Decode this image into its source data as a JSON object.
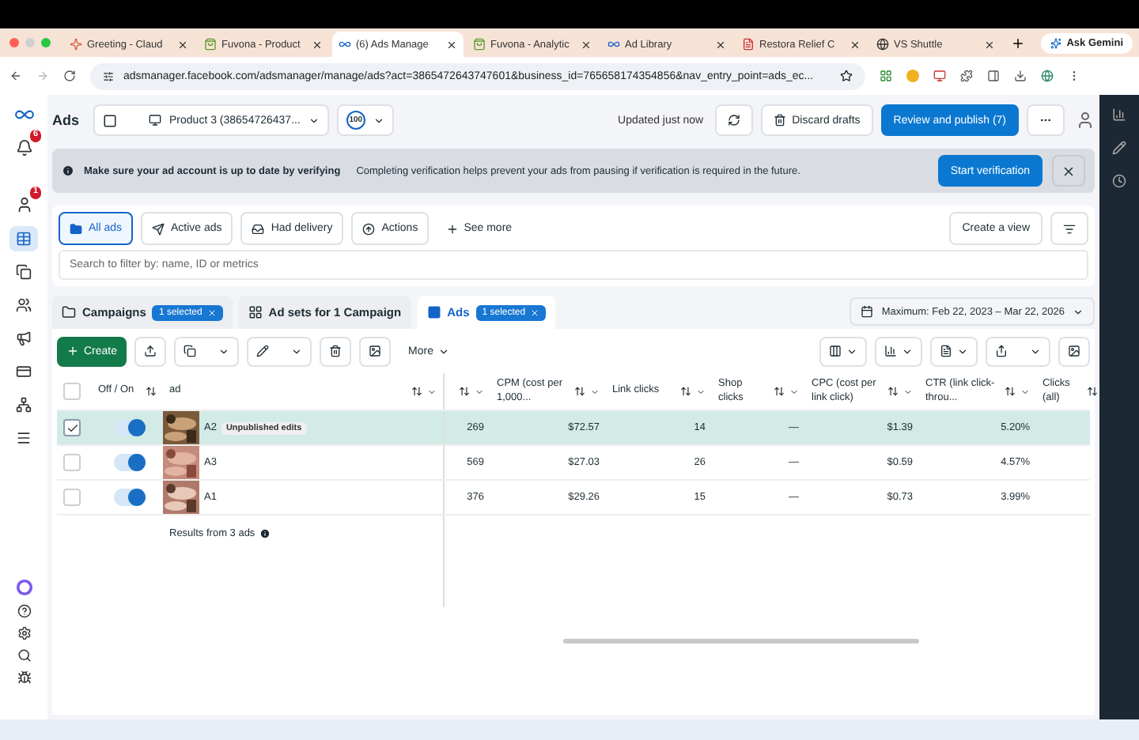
{
  "browser_tabs": [
    {
      "title": "Greeting - Claud",
      "kind": "spark",
      "selected": false
    },
    {
      "title": "Fuvona - Product",
      "kind": "bag",
      "selected": false
    },
    {
      "title": "(6) Ads Manage",
      "kind": "meta",
      "selected": true
    },
    {
      "title": "Fuvona - Analytic",
      "kind": "bag",
      "selected": false
    },
    {
      "title": "Ad Library",
      "kind": "meta",
      "selected": false
    },
    {
      "title": "Restora Relief C",
      "kind": "page",
      "selected": false
    },
    {
      "title": "VS Shuttle",
      "kind": "globe",
      "selected": false
    }
  ],
  "gemini": "Ask Gemini",
  "address": "adsmanager.facebook.com/adsmanager/manage/ads?act=3865472643747601&business_id=765658174354856&nav_entry_point=ads_ec...",
  "sidebar": {
    "badges": [
      "6",
      "1"
    ],
    "items": [
      {
        "kind": "table",
        "selected": true
      },
      {
        "kind": "copy",
        "selected": false
      },
      {
        "kind": "users",
        "selected": false
      },
      {
        "kind": "megaphone",
        "selected": false
      },
      {
        "kind": "card",
        "selected": false
      },
      {
        "kind": "network",
        "selected": false
      },
      {
        "kind": "menu",
        "selected": false
      }
    ]
  },
  "header": {
    "title": "Ads",
    "account": "Product 3 (38654726437...",
    "score": "100",
    "updated": "Updated just now",
    "discard": "Discard drafts",
    "publish": "Review and publish (7)"
  },
  "banner": {
    "heading": "Make sure your ad account is up to date by verifying",
    "text": "Completing verification helps prevent your ads from pausing if verification is required in the future.",
    "button": "Start verification"
  },
  "filters": [
    {
      "label": "All ads",
      "kind": "folder",
      "selected": true
    },
    {
      "label": "Active ads",
      "kind": "send",
      "selected": false
    },
    {
      "label": "Had delivery",
      "kind": "inbox",
      "selected": false
    },
    {
      "label": "Actions",
      "kind": "action",
      "selected": false
    }
  ],
  "see_more": "See more",
  "create_view": "Create a view",
  "search": {
    "placeholder": "Search to filter by: name, ID or metrics"
  },
  "levels": [
    {
      "label": "Campaigns",
      "badge": "1 selected",
      "kind": "folder",
      "selected": false
    },
    {
      "label": "Ad sets for 1 Campaign",
      "kind": "grid",
      "selected": false
    },
    {
      "label": "Ads",
      "badge": "1 selected",
      "kind": "ad",
      "selected": true
    }
  ],
  "date_range": "Maximum: Feb 22, 2023 – Mar 22, 2026",
  "toolbar": {
    "create": "Create",
    "more": "More"
  },
  "table": {
    "all_selected": false,
    "toggle_header": "Off / On",
    "name_header": "ad",
    "columns": [
      {},
      {
        "label": "CPM (cost per 1,000..."
      },
      {
        "label": "Link clicks"
      },
      {
        "label": "Shop clicks"
      },
      {
        "label": "CPC (cost per link click)"
      },
      {
        "label": "CTR (link click-throu..."
      },
      {
        "label": "Clicks (all)"
      }
    ],
    "rows": [
      {
        "name": "A2",
        "badge": "Unpublished edits",
        "selected": true,
        "on": true,
        "values": [
          "269",
          "$72.57",
          "14",
          "—",
          "$1.39",
          "5.20%"
        ]
      },
      {
        "name": "A3",
        "selected": false,
        "on": true,
        "values": [
          "569",
          "$27.03",
          "26",
          "—",
          "$0.59",
          "4.57%"
        ]
      },
      {
        "name": "A1",
        "selected": false,
        "on": true,
        "values": [
          "376",
          "$29.26",
          "15",
          "—",
          "$0.73",
          "3.99%"
        ]
      }
    ],
    "results": "Results from 3 ads"
  }
}
